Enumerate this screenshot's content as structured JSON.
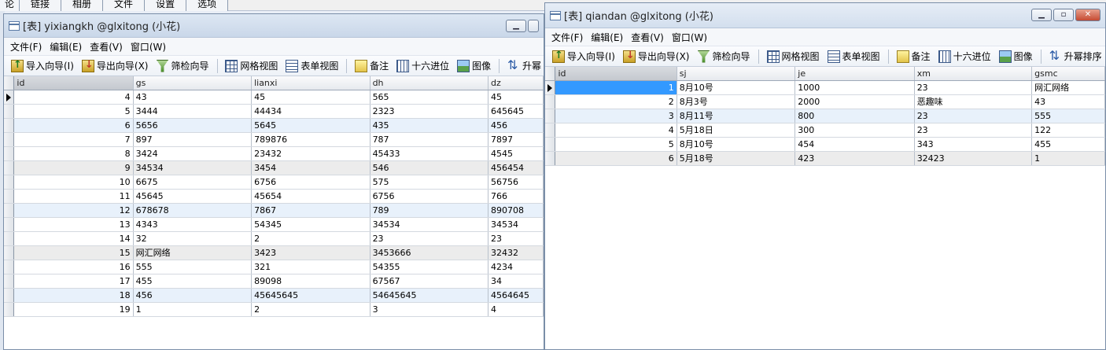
{
  "background_app": {
    "tabs": [
      "论",
      "链接",
      "相册",
      "文件",
      "设置",
      "选项"
    ]
  },
  "left_window": {
    "title": "[表] yixiangkh @glxitong (小花)",
    "menu": [
      "文件(F)",
      "编辑(E)",
      "查看(V)",
      "窗口(W)"
    ],
    "toolbar": {
      "import": "导入向导(I)",
      "export": "导出向导(X)",
      "filter": "筛检向导",
      "grid_view": "网格视图",
      "form_view": "表单视图",
      "memo": "备注",
      "hex": "十六进位",
      "image": "图像",
      "sort": "升幂"
    },
    "columns": [
      "id",
      "gs",
      "lianxi",
      "dh",
      "dz"
    ],
    "rows": [
      [
        "4",
        "43",
        "45",
        "565",
        "45"
      ],
      [
        "5",
        "3444",
        "44434",
        "2323",
        "645645"
      ],
      [
        "6",
        "5656",
        "5645",
        "435",
        "456"
      ],
      [
        "7",
        "897",
        "789876",
        "787",
        "7897"
      ],
      [
        "8",
        "3424",
        "23432",
        "45433",
        "4545"
      ],
      [
        "9",
        "34534",
        "3454",
        "546",
        "456454"
      ],
      [
        "10",
        "6675",
        "6756",
        "575",
        "56756"
      ],
      [
        "11",
        "45645",
        "45654",
        "6756",
        "766"
      ],
      [
        "12",
        "678678",
        "7867",
        "789",
        "890708"
      ],
      [
        "13",
        "4343",
        "54345",
        "34534",
        "34534"
      ],
      [
        "14",
        "32",
        "2",
        "23",
        "23"
      ],
      [
        "15",
        "网汇网络",
        "3423",
        "3453666",
        "32432"
      ],
      [
        "16",
        "555",
        "321",
        "54355",
        "4234"
      ],
      [
        "17",
        "455",
        "89098",
        "67567",
        "34"
      ],
      [
        "18",
        "456",
        "45645645",
        "54645645",
        "4564645"
      ],
      [
        "19",
        "1",
        "2",
        "3",
        "4"
      ]
    ]
  },
  "right_window": {
    "title": "[表] qiandan @glxitong (小花)",
    "menu": [
      "文件(F)",
      "编辑(E)",
      "查看(V)",
      "窗口(W)"
    ],
    "toolbar": {
      "import": "导入向导(I)",
      "export": "导出向导(X)",
      "filter": "筛检向导",
      "grid_view": "网格视图",
      "form_view": "表单视图",
      "memo": "备注",
      "hex": "十六进位",
      "image": "图像",
      "sort": "升幂排序"
    },
    "columns": [
      "id",
      "sj",
      "je",
      "xm",
      "gsmc"
    ],
    "rows": [
      [
        "1",
        "8月10号",
        "1000",
        "23",
        "网汇网络"
      ],
      [
        "2",
        "8月3号",
        "2000",
        "恶趣味",
        "43"
      ],
      [
        "3",
        "8月11号",
        "800",
        "23",
        "555"
      ],
      [
        "4",
        "5月18日",
        "300",
        "23",
        "122"
      ],
      [
        "5",
        "8月10号",
        "454",
        "343",
        "455"
      ],
      [
        "6",
        "5月18号",
        "423",
        "32423",
        "1"
      ]
    ]
  },
  "colors": {
    "selection": "#3399ff",
    "alt_row": "#e8f1fb",
    "title_gradient_top": "#dde7f3"
  }
}
